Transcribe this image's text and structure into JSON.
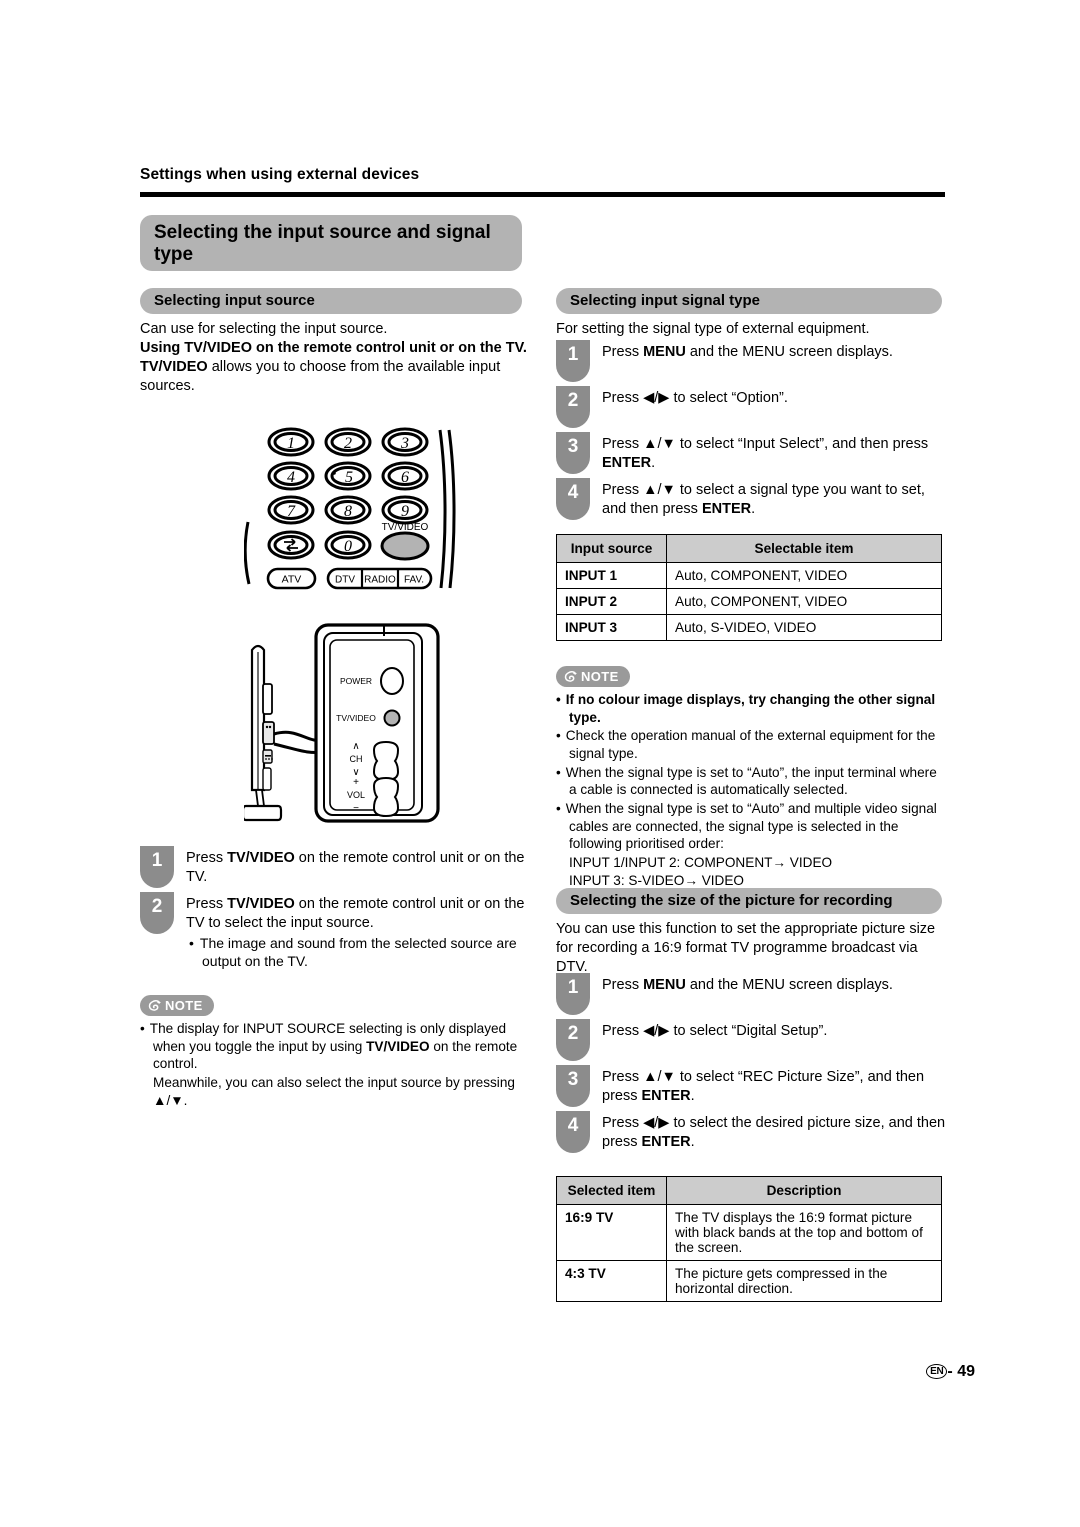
{
  "running_head": "Settings when using external devices",
  "page_title": "Selecting the input source and signal type",
  "footer": {
    "lang_mark": "EN",
    "separator": "-",
    "page_number": "49"
  },
  "colors": {
    "banner_gray": "#b3b3b3",
    "badge_gray": "#8c8c8c",
    "table_header_gray": "#cccccc",
    "note_gray": "#9a9a9a",
    "rule_black": "#000000"
  },
  "left_column": {
    "section_heading": "Selecting input source",
    "intro_line1": "Can use for selecting the input source.",
    "intro_bold": "Using TV/VIDEO on the remote control unit or on the TV.",
    "intro_line3_bold": "TV/VIDEO",
    "intro_line3_rest": " allows you to choose from the available input sources.",
    "figure_remote": {
      "name": "remote-control-keypad",
      "keys": [
        "1",
        "2",
        "3",
        "4",
        "5",
        "6",
        "7",
        "8",
        "9",
        "flashback",
        "0"
      ],
      "tvvideo_label": "TV/VIDEO",
      "mode_buttons": [
        "ATV",
        "DTV",
        "RADIO",
        "FAV."
      ]
    },
    "figure_tv": {
      "name": "tv-side-control-panel",
      "labels": [
        "POWER",
        "TV/VIDEO",
        "CH",
        "VOL"
      ],
      "ch_up": "∧",
      "ch_down": "∨",
      "vol_up": "+",
      "vol_down": "−"
    },
    "steps": [
      {
        "number": "1",
        "text_parts": [
          {
            "t": "Press ",
            "b": false
          },
          {
            "t": "TV/VIDEO",
            "b": true
          },
          {
            "t": " on the remote control unit or on the TV.",
            "b": false
          }
        ],
        "sub": []
      },
      {
        "number": "2",
        "text_parts": [
          {
            "t": "Press ",
            "b": false
          },
          {
            "t": "TV/VIDEO",
            "b": true
          },
          {
            "t": " on the remote control unit or on the TV to select the input source.",
            "b": false
          }
        ],
        "sub": [
          "The image and sound from the selected source are output on the TV."
        ]
      }
    ],
    "note": {
      "label": "NOTE",
      "items": [
        {
          "parts": [
            {
              "t": "The display for INPUT SOURCE selecting is only displayed when you toggle the input by using ",
              "b": false
            },
            {
              "t": "TV/VIDEO",
              "b": true
            },
            {
              "t": " on the remote control.",
              "b": false
            }
          ],
          "continuation": "Meanwhile, you can also select the input source by pressing ▲/▼."
        }
      ]
    }
  },
  "right_column": {
    "signal_type": {
      "section_heading": "Selecting input signal type",
      "intro": "For setting the signal type of external equipment.",
      "steps": [
        {
          "number": "1",
          "text_parts": [
            {
              "t": "Press ",
              "b": false
            },
            {
              "t": "MENU",
              "b": true
            },
            {
              "t": " and the MENU screen displays.",
              "b": false
            }
          ]
        },
        {
          "number": "2",
          "text_parts": [
            {
              "t": "Press ◀/▶ to select “Option”.",
              "b": false
            }
          ]
        },
        {
          "number": "3",
          "text_parts": [
            {
              "t": "Press ▲/▼ to select “Input Select”, and then press ",
              "b": false
            },
            {
              "t": "ENTER",
              "b": true
            },
            {
              "t": ".",
              "b": false
            }
          ]
        },
        {
          "number": "4",
          "text_parts": [
            {
              "t": "Press ▲/▼ to select a signal type you want to set, and then press ",
              "b": false
            },
            {
              "t": "ENTER",
              "b": true
            },
            {
              "t": ".",
              "b": false
            }
          ]
        }
      ],
      "table": {
        "headers": [
          "Input source",
          "Selectable item"
        ],
        "rows": [
          [
            "INPUT 1",
            "Auto, COMPONENT, VIDEO"
          ],
          [
            "INPUT 2",
            "Auto, COMPONENT, VIDEO"
          ],
          [
            "INPUT 3",
            "Auto, S-VIDEO, VIDEO"
          ]
        ]
      },
      "note": {
        "label": "NOTE",
        "items": [
          {
            "text": "If no colour image displays, try changing the other signal type.",
            "bold": true
          },
          {
            "text": "Check the operation manual of the external equipment for the signal type.",
            "bold": false
          },
          {
            "text": "When the signal type is set to “Auto”, the input terminal where a cable is connected is automatically selected.",
            "bold": false
          },
          {
            "text": "When the signal type is set to “Auto” and multiple video signal cables are connected, the signal type is selected in the following prioritised order:",
            "bold": false
          }
        ],
        "priority_lines": [
          "INPUT 1/INPUT 2: COMPONENT→ VIDEO",
          "INPUT 3: S-VIDEO→ VIDEO"
        ]
      }
    },
    "rec_size": {
      "section_heading": "Selecting the size of the picture for recording",
      "intro": "You can use this function to set the appropriate picture size for recording a 16:9 format TV programme broadcast via DTV.",
      "steps": [
        {
          "number": "1",
          "text_parts": [
            {
              "t": "Press ",
              "b": false
            },
            {
              "t": "MENU",
              "b": true
            },
            {
              "t": " and the MENU screen displays.",
              "b": false
            }
          ]
        },
        {
          "number": "2",
          "text_parts": [
            {
              "t": "Press ◀/▶ to select “Digital Setup”.",
              "b": false
            }
          ]
        },
        {
          "number": "3",
          "text_parts": [
            {
              "t": "Press ▲/▼ to select “REC Picture Size”, and then press ",
              "b": false
            },
            {
              "t": "ENTER",
              "b": true
            },
            {
              "t": ".",
              "b": false
            }
          ]
        },
        {
          "number": "4",
          "text_parts": [
            {
              "t": "Press ◀/▶ to select the desired picture size, and then press ",
              "b": false
            },
            {
              "t": "ENTER",
              "b": true
            },
            {
              "t": ".",
              "b": false
            }
          ]
        }
      ],
      "table": {
        "headers": [
          "Selected item",
          "Description"
        ],
        "rows": [
          [
            "16:9 TV",
            "The TV displays the 16:9 format picture with black bands at the top and bottom of the screen."
          ],
          [
            "4:3 TV",
            "The picture gets compressed in the horizontal direction."
          ]
        ]
      }
    }
  }
}
